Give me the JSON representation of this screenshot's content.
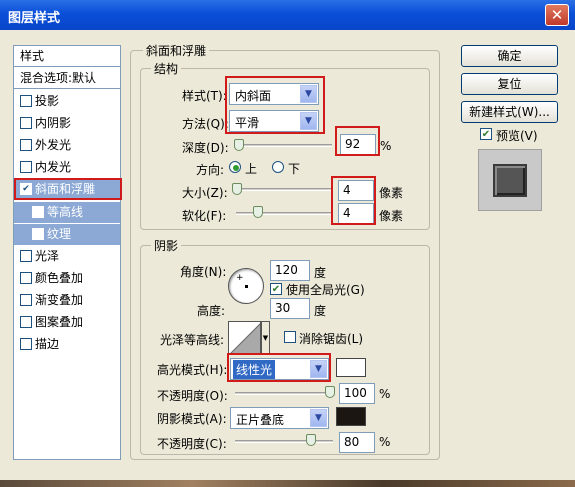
{
  "window": {
    "title": "图层样式",
    "close_symbol": "✕"
  },
  "sidebar": {
    "header": "样式",
    "blend_options": "混合选项:默认",
    "items": [
      {
        "label": "投影",
        "checked": false
      },
      {
        "label": "内阴影",
        "checked": false
      },
      {
        "label": "外发光",
        "checked": false
      },
      {
        "label": "内发光",
        "checked": false
      },
      {
        "label": "斜面和浮雕",
        "checked": true
      },
      {
        "label": "等高线",
        "checked": false
      },
      {
        "label": "纹理",
        "checked": false
      },
      {
        "label": "光泽",
        "checked": false
      },
      {
        "label": "颜色叠加",
        "checked": false
      },
      {
        "label": "渐变叠加",
        "checked": false
      },
      {
        "label": "图案叠加",
        "checked": false
      },
      {
        "label": "描边",
        "checked": false
      }
    ]
  },
  "bevel": {
    "section_title": "斜面和浮雕",
    "structure_title": "结构",
    "style_label": "样式(T):",
    "style_value": "内斜面",
    "technique_label": "方法(Q):",
    "technique_value": "平滑",
    "depth_label": "深度(D):",
    "depth_value": "92",
    "depth_unit": "%",
    "direction_label": "方向:",
    "direction_up": "上",
    "direction_down": "下",
    "size_label": "大小(Z):",
    "size_value": "4",
    "size_unit": "像素",
    "soften_label": "软化(F):",
    "soften_value": "4",
    "soften_unit": "像素"
  },
  "shading": {
    "title": "阴影",
    "angle_label": "角度(N):",
    "angle_value": "120",
    "angle_unit": "度",
    "global_light_label": "使用全局光(G)",
    "global_light_checked": true,
    "altitude_label": "高度:",
    "altitude_value": "30",
    "altitude_unit": "度",
    "gloss_contour_label": "光泽等高线:",
    "anti_alias_label": "消除锯齿(L)",
    "anti_alias_checked": false,
    "highlight_mode_label": "高光模式(H):",
    "highlight_mode_value": "线性光",
    "highlight_color": "#ffffff",
    "highlight_opacity_label": "不透明度(O):",
    "highlight_opacity_value": "100",
    "highlight_opacity_unit": "%",
    "shadow_mode_label": "阴影模式(A):",
    "shadow_mode_value": "正片叠底",
    "shadow_color": "#1b1612",
    "shadow_opacity_label": "不透明度(C):",
    "shadow_opacity_value": "80",
    "shadow_opacity_unit": "%"
  },
  "buttons": {
    "ok": "确定",
    "reset": "复位",
    "new_style": "新建样式(W)...",
    "preview_label": "预览(V)",
    "preview_checked": true
  },
  "levels": {
    "depth": 0.0,
    "size": 0.0,
    "soften": 0.25,
    "highlight_opacity": 1.0,
    "shadow_opacity": 0.8
  }
}
